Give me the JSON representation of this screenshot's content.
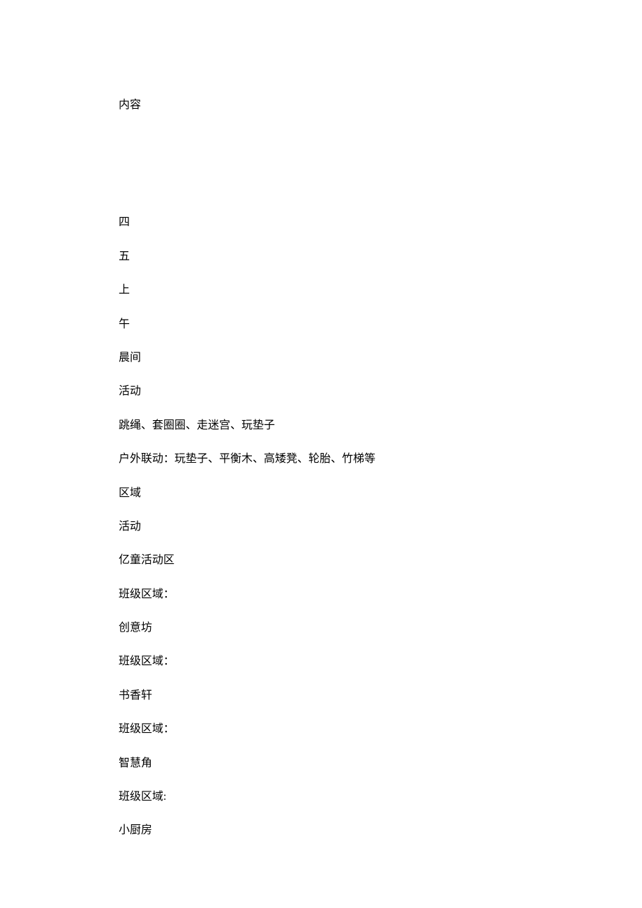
{
  "lines": [
    "内容",
    "",
    "四",
    "五",
    "上",
    "午",
    "晨间",
    "活动",
    "跳绳、套圈圈、走迷宫、玩垫子",
    "户外联动：玩垫子、平衡木、高矮凳、轮胎、竹梯等",
    "区域",
    "活动",
    "亿童活动区",
    "班级区域：",
    "创意坊",
    "班级区域：",
    "书香轩",
    "班级区域：",
    "智慧角",
    "班级区域:",
    "小厨房"
  ]
}
